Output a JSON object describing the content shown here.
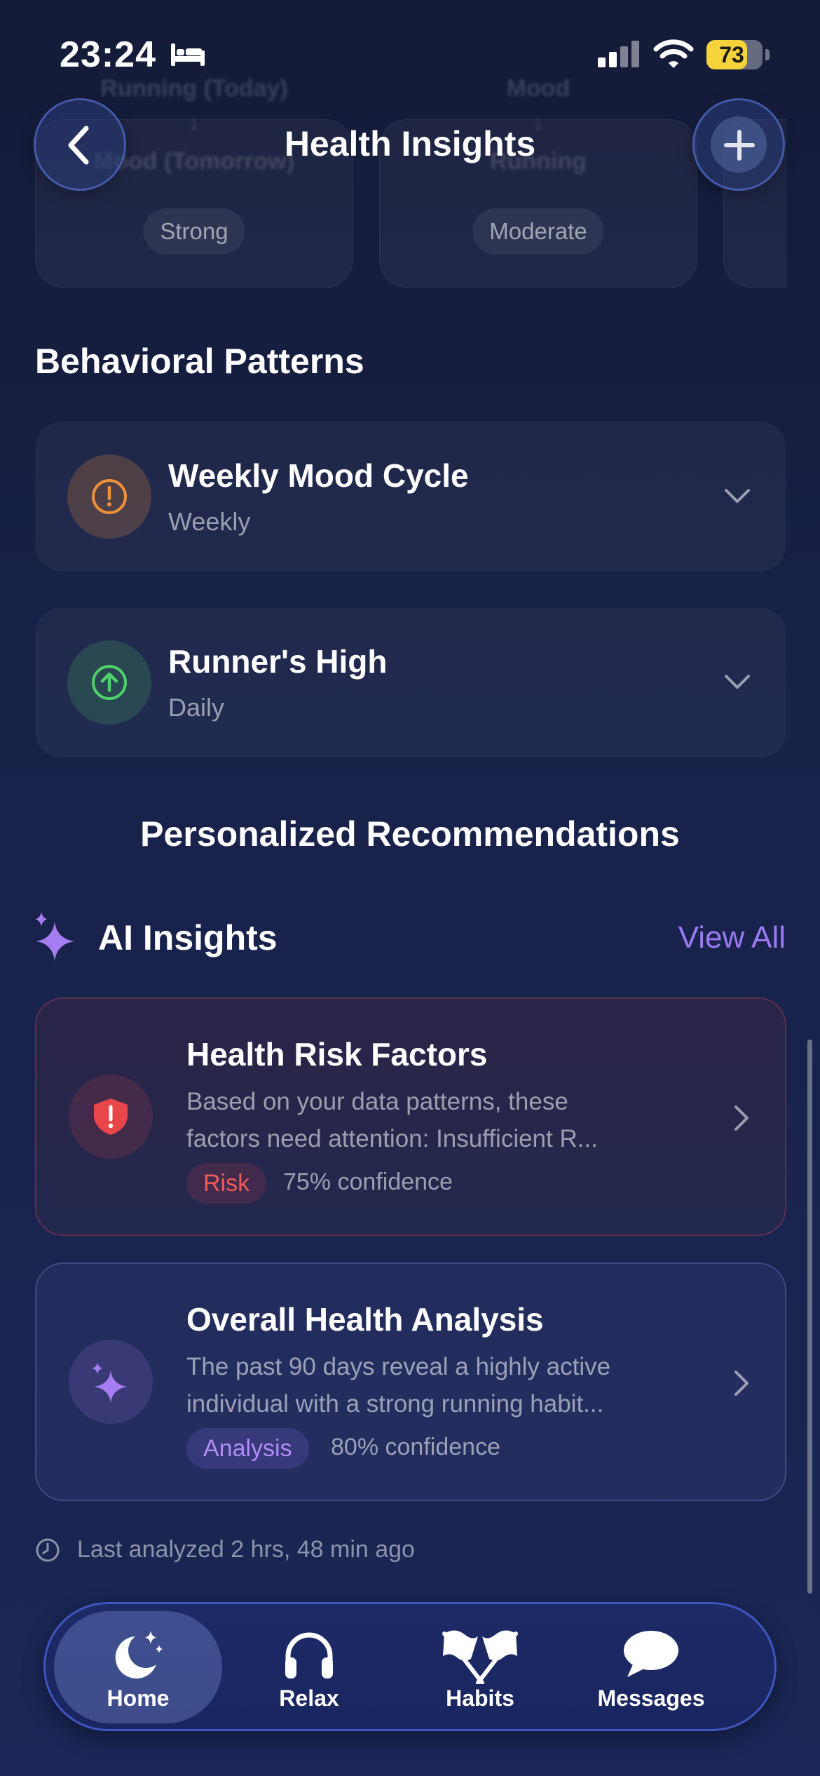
{
  "status_bar": {
    "time": "23:24",
    "battery": "73",
    "battery_level": 0.73
  },
  "header": {
    "title": "Health Insights"
  },
  "correlation_cards": [
    {
      "line1": "Running (Today)",
      "arrow": "↓",
      "line2": "Mood (Tomorrow)",
      "strength": "Strong"
    },
    {
      "line1": "Mood",
      "arrow": "↓",
      "line2": "Running",
      "strength": "Moderate"
    }
  ],
  "behavioral_patterns": {
    "title": "Behavioral Patterns",
    "items": [
      {
        "title": "Weekly Mood Cycle",
        "frequency": "Weekly",
        "icon": "exclamation-circle-icon",
        "color": "#f0913a"
      },
      {
        "title": "Runner's High",
        "frequency": "Daily",
        "icon": "arrow-up-circle-icon",
        "color": "#4fd16a"
      }
    ]
  },
  "recommendations": {
    "title": "Personalized Recommendations"
  },
  "ai_insights": {
    "title": "AI Insights",
    "view_all": "View All",
    "items": [
      {
        "title": "Health Risk Factors",
        "desc_line1": "Based on your data patterns, these",
        "desc_line2": "factors need attention: Insufficient R...",
        "tag": "Risk",
        "confidence": "75% confidence",
        "icon": "shield-alert-icon",
        "color": "#e8474a"
      },
      {
        "title": "Overall Health Analysis",
        "desc_line1": "The past 90 days reveal a highly active",
        "desc_line2": "individual with a strong running habit...",
        "tag": "Analysis",
        "confidence": "80% confidence",
        "icon": "sparkles-icon",
        "color": "#a67ef2"
      }
    ],
    "last_analyzed": "Last analyzed 2 hrs, 48 min ago"
  },
  "tab_bar": {
    "tabs": [
      {
        "label": "Home",
        "icon": "moon-stars-icon",
        "active": true
      },
      {
        "label": "Relax",
        "icon": "headphones-icon",
        "active": false
      },
      {
        "label": "Habits",
        "icon": "flags-icon",
        "active": false
      },
      {
        "label": "Messages",
        "icon": "chat-bubble-icon",
        "active": false
      }
    ]
  },
  "colors": {
    "accent": "#9c79f0",
    "background": "#18224a",
    "risk": "#ef5b5b",
    "battery": "#f5d33a"
  }
}
